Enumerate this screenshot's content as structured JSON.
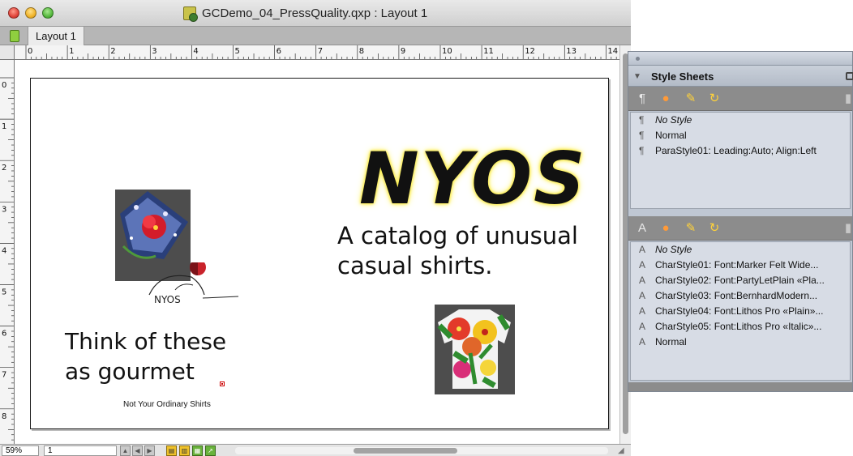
{
  "window": {
    "title": "GCDemo_04_PressQuality.qxp : Layout 1",
    "tab_label": "Layout 1"
  },
  "rulers": {
    "horizontal_ticks": [
      "0",
      "1",
      "2",
      "3",
      "4",
      "5",
      "6",
      "7",
      "8",
      "9",
      "10",
      "11",
      "12",
      "13",
      "14"
    ],
    "vertical_ticks": [
      "0",
      "1",
      "2",
      "3",
      "4",
      "5",
      "6",
      "7",
      "8"
    ]
  },
  "page": {
    "headline_logo": "NYOS",
    "catalog_lines": [
      "A catalog of unusual",
      "casual shirts."
    ],
    "think_lines": [
      "Think of these",
      "as gourmet"
    ],
    "tagline": "Not Your Ordinary Shirts",
    "small_logo_text": "NYOS"
  },
  "status_bar": {
    "zoom": "59%",
    "page_number": "1"
  },
  "palette": {
    "title": "Style Sheets",
    "paragraph_styles": [
      {
        "label": "No Style",
        "italic": true
      },
      {
        "label": "Normal",
        "italic": false
      },
      {
        "label": "ParaStyle01: Leading:Auto; Align:Left",
        "italic": false
      }
    ],
    "character_styles": [
      {
        "label": "No Style",
        "italic": true
      },
      {
        "label": "CharStyle01: Font:Marker Felt Wide...",
        "italic": false
      },
      {
        "label": "CharStyle02: Font:PartyLetPlain «Pla...",
        "italic": false
      },
      {
        "label": "CharStyle03: Font:BernhardModern...",
        "italic": false
      },
      {
        "label": "CharStyle04: Font:Lithos Pro «Plain»...",
        "italic": false
      },
      {
        "label": "CharStyle05: Font:Lithos Pro «Italic»...",
        "italic": false
      },
      {
        "label": "Normal",
        "italic": false
      }
    ]
  },
  "colors": {
    "logo_glow": "#f7ec4a",
    "palette_bg": "#bfc7d3",
    "palette_toolbar": "#8c8c8c",
    "photo_bg": "#4d4d4d"
  }
}
